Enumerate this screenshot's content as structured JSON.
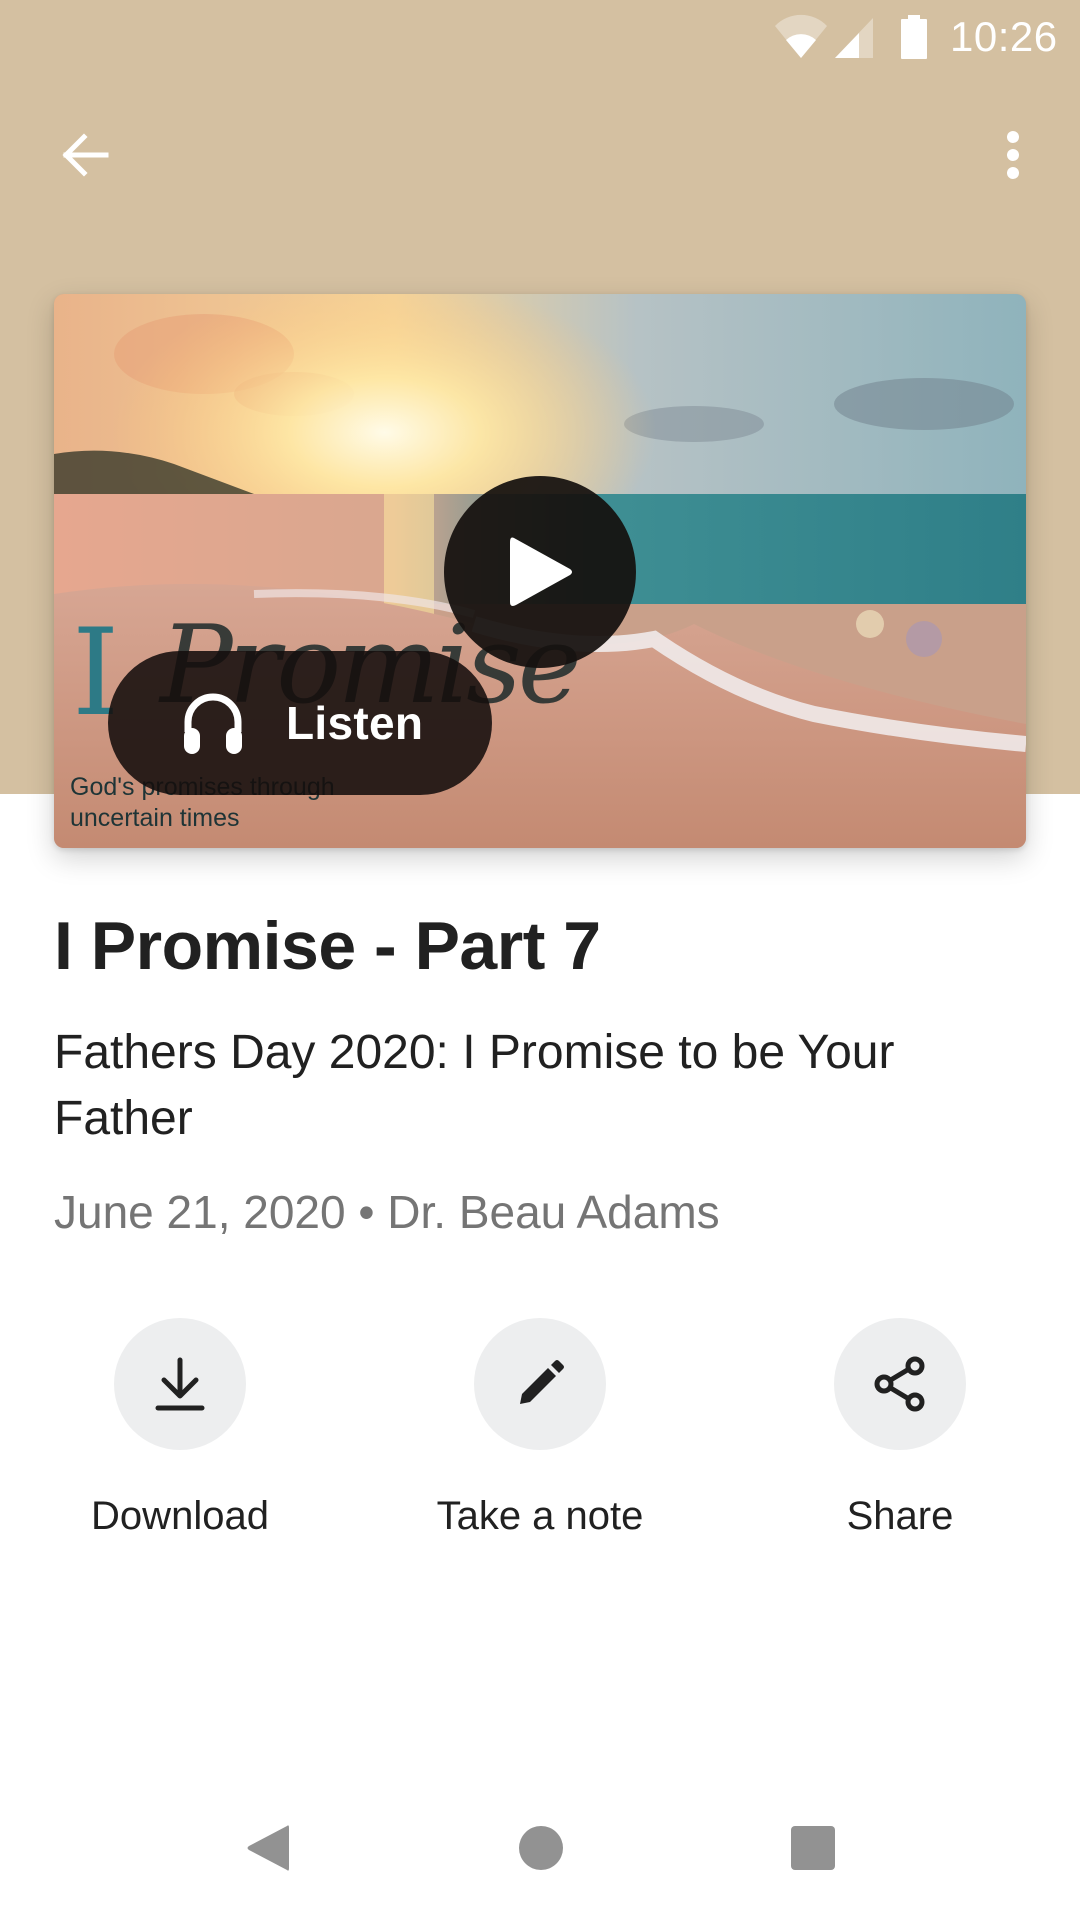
{
  "status_bar": {
    "time": "10:26",
    "icons": [
      "wifi-icon",
      "signal-icon",
      "battery-icon"
    ]
  },
  "toolbar": {
    "back_icon": "arrow-left-icon",
    "menu_icon": "more-vertical-icon"
  },
  "colors": {
    "header_background": "#D4C0A1",
    "title_text": "#212121",
    "meta_text": "#757575",
    "action_circle": "#EDEEEF",
    "nav_icons": "#929292"
  },
  "media": {
    "artwork": {
      "title_first": "I",
      "title_rest": "Promise",
      "tagline": "God's promises through uncertain times"
    },
    "play_icon": "play-icon",
    "listen_button": {
      "icon": "headphones-icon",
      "label": "Listen"
    }
  },
  "sermon": {
    "title": "I Promise - Part 7",
    "subtitle": "Fathers Day 2020: I Promise to be Your Father",
    "date": "June 21, 2020",
    "separator": "•",
    "speaker": "Dr. Beau Adams"
  },
  "actions": [
    {
      "icon": "download-icon",
      "label": "Download"
    },
    {
      "icon": "pencil-icon",
      "label": "Take a note"
    },
    {
      "icon": "share-icon",
      "label": "Share"
    }
  ],
  "nav_bar": {
    "icons": [
      "nav-back-icon",
      "nav-home-icon",
      "nav-recents-icon"
    ]
  }
}
